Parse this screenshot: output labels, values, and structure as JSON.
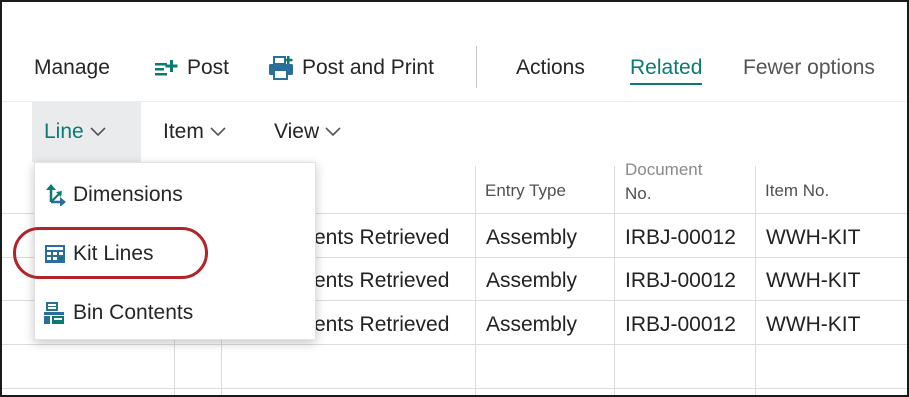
{
  "ribbon": {
    "manage": "Manage",
    "post": "Post",
    "post_and_print": "Post and Print",
    "actions": "Actions",
    "related": "Related",
    "fewer_options": "Fewer options"
  },
  "subtabs": [
    {
      "label": "Line",
      "selected": true
    },
    {
      "label": "Item",
      "selected": false
    },
    {
      "label": "View",
      "selected": false
    }
  ],
  "table": {
    "headers": {
      "entry_type": "Entry Type",
      "document_no_line1": "Document",
      "document_no_line2": "No.",
      "item_no": "Item No."
    },
    "rows": [
      {
        "status": "ents Retrieved",
        "entry_type": "Assembly",
        "document_no": "IRBJ-00012",
        "item_no": "WWH-KIT"
      },
      {
        "status": "ents Retrieved",
        "entry_type": "Assembly",
        "document_no": "IRBJ-00012",
        "item_no": "WWH-KIT"
      },
      {
        "status": "ents Retrieved",
        "entry_type": "Assembly",
        "document_no": "IRBJ-00012",
        "item_no": "WWH-KIT"
      }
    ]
  },
  "dropdown": {
    "items": [
      {
        "label": "Dimensions",
        "icon": "dimensions-icon"
      },
      {
        "label": "Kit Lines",
        "icon": "kit-lines-icon"
      },
      {
        "label": "Bin Contents",
        "icon": "bin-contents-icon"
      }
    ]
  },
  "colors": {
    "accent": "#0b7a75",
    "highlight_ring": "#b0242a",
    "selected_tab_bg": "#e9ebed"
  }
}
